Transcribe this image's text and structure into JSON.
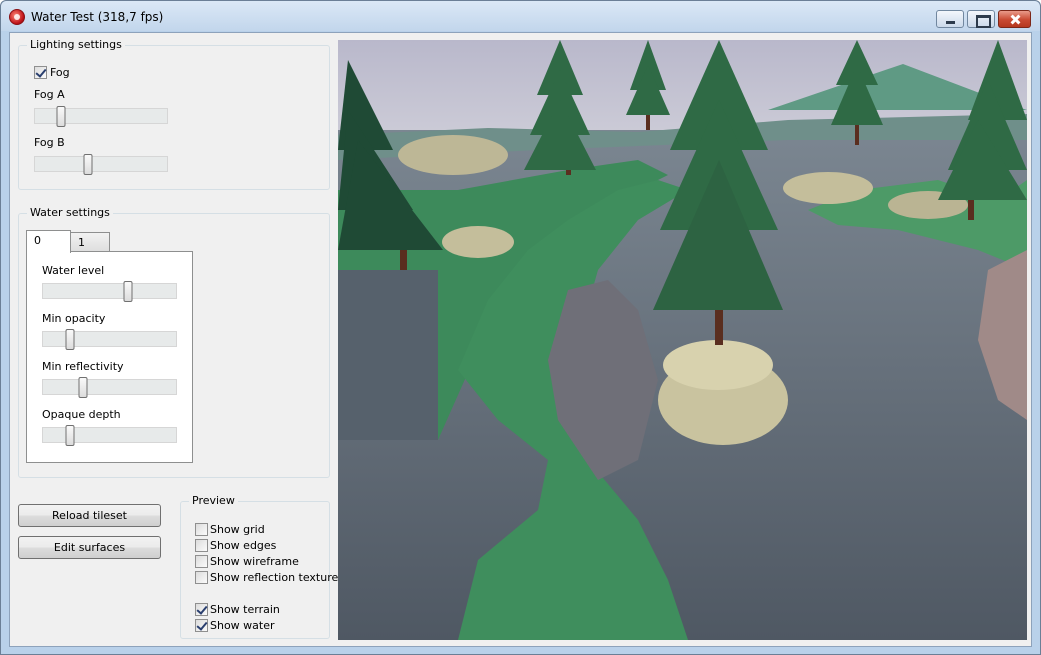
{
  "window": {
    "title": "Water Test (318,7 fps)"
  },
  "lighting": {
    "group_title": "Lighting settings",
    "fog_label": "Fog",
    "fog_checked": true,
    "fog_a_label": "Fog A",
    "fog_a_value": 0.2,
    "fog_b_label": "Fog B",
    "fog_b_value": 0.4
  },
  "water": {
    "group_title": "Water settings",
    "tabs": [
      {
        "label": "0",
        "active": true
      },
      {
        "label": "1",
        "active": false
      }
    ],
    "sliders": [
      {
        "label": "Water level",
        "value": 0.64
      },
      {
        "label": "Min opacity",
        "value": 0.2
      },
      {
        "label": "Min reflectivity",
        "value": 0.3
      },
      {
        "label": "Opaque depth",
        "value": 0.2
      }
    ]
  },
  "buttons": {
    "reload_tileset": "Reload tileset",
    "edit_surfaces": "Edit surfaces"
  },
  "preview": {
    "group_title": "Preview",
    "options": [
      {
        "label": "Show grid",
        "checked": false
      },
      {
        "label": "Show edges",
        "checked": false
      },
      {
        "label": "Show wireframe",
        "checked": false
      },
      {
        "label": "Show reflection texture",
        "checked": false
      },
      {
        "label": "Show terrain",
        "checked": true
      },
      {
        "label": "Show water",
        "checked": true
      }
    ]
  },
  "icons": {
    "app": "app-icon",
    "minimize": "minimize-icon",
    "maximize": "maximize-icon",
    "close": "close-icon"
  },
  "colors": {
    "sky": "#c4c4d4",
    "water": "#5d6671",
    "grass": "#3f8e5d",
    "tree": "#2f5a3c",
    "rock": "#c9c39f"
  }
}
